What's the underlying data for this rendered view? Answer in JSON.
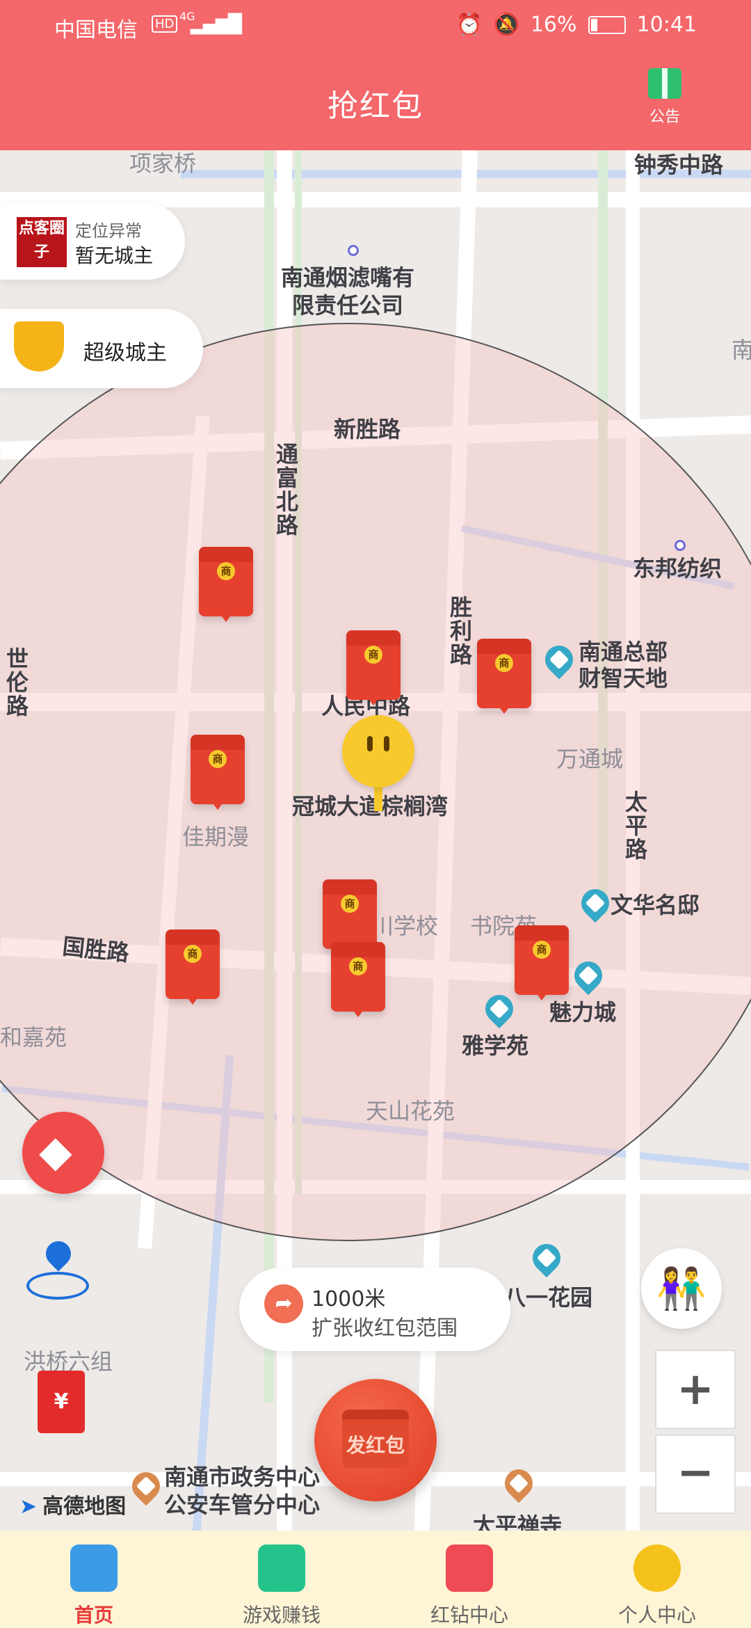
{
  "status_bar": {
    "carrier": "中国电信",
    "hd_badge": "HD",
    "network": "4G",
    "battery": "16%",
    "time": "10:41"
  },
  "header": {
    "title": "抢红包",
    "notice_label": "公告"
  },
  "city_owner": {
    "logo_text": "点客圈子",
    "status": "定位异常",
    "owner": "暂无城主"
  },
  "super_owner": {
    "label": "超级城主"
  },
  "map": {
    "labels": [
      {
        "text": "项家桥"
      },
      {
        "text": "钟秀中路"
      },
      {
        "text": "南通烟滤嘴有"
      },
      {
        "text": "限责任公司"
      },
      {
        "text": "新胜路"
      },
      {
        "text": "通富北路"
      },
      {
        "text": "东邦纺织"
      },
      {
        "text": "胜利路"
      },
      {
        "text": "南通总部"
      },
      {
        "text": "财智天地"
      },
      {
        "text": "人民中路"
      },
      {
        "text": "万通城"
      },
      {
        "text": "冠城大道棕榈湾"
      },
      {
        "text": "佳期漫"
      },
      {
        "text": "太平路"
      },
      {
        "text": "文华名邸"
      },
      {
        "text": "川学校"
      },
      {
        "text": "书院苑"
      },
      {
        "text": "国胜路"
      },
      {
        "text": "魅力城"
      },
      {
        "text": "雅学苑"
      },
      {
        "text": "和嘉苑"
      },
      {
        "text": "天山花苑"
      },
      {
        "text": "八一花园"
      },
      {
        "text": "洪桥六组"
      },
      {
        "text": "南通市政务中心"
      },
      {
        "text": "公安车管分中心"
      },
      {
        "text": "太平禅寺"
      },
      {
        "text": "世伦路"
      },
      {
        "text": "南"
      }
    ],
    "envelope_mark": "商",
    "amap_label": "高德地图"
  },
  "range": {
    "distance": "1000米",
    "action": "扩张收红包范围"
  },
  "send_button": {
    "label": "发红包"
  },
  "red_envelope_icon": "¥",
  "zoom": {
    "in": "+",
    "out": "−"
  },
  "bottom_nav": {
    "items": [
      {
        "label": "首页",
        "icon": "box-icon",
        "active": true
      },
      {
        "label": "游戏赚钱",
        "icon": "game-mail-icon",
        "active": false
      },
      {
        "label": "红钻中心",
        "icon": "cursor-icon",
        "active": false
      },
      {
        "label": "个人中心",
        "icon": "smile-icon",
        "active": false
      }
    ]
  },
  "colors": {
    "header": "#f4676a",
    "accent_red": "#e6402f",
    "nav_bg": "#fdf5d6",
    "active_label": "#e83a3a"
  }
}
